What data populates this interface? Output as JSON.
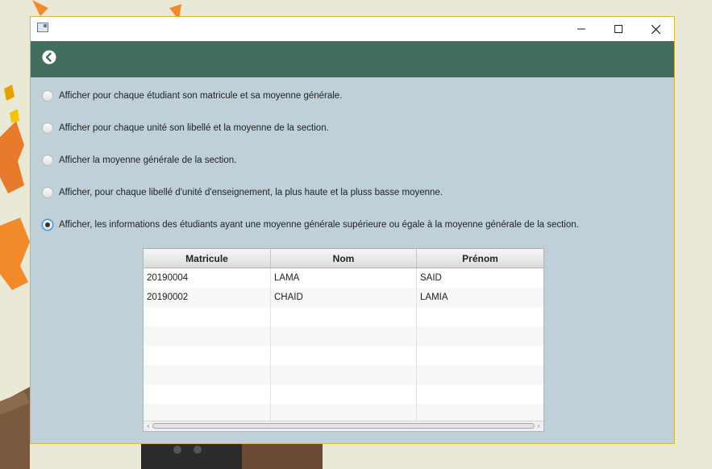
{
  "window": {
    "icon": "app-window-icon",
    "controls": [
      "minimize-icon",
      "maximize-icon",
      "close-icon"
    ]
  },
  "header": {
    "back_icon": "back-arrow-circle-icon",
    "color": "#436d5e"
  },
  "options": [
    {
      "label": "Afficher pour chaque étudiant son matricule et sa moyenne générale.",
      "checked": false
    },
    {
      "label": "Afficher pour chaque unité son libellé et la moyenne de la section.",
      "checked": false
    },
    {
      "label": "Afficher la moyenne générale de la section.",
      "checked": false
    },
    {
      "label": "Afficher, pour chaque libellé d'unité d'enseignement, la plus haute et la pluss basse moyenne.",
      "checked": false
    },
    {
      "label": "Afficher, les informations des étudiants ayant une moyenne générale supérieure ou égale à la moyenne générale de la section.",
      "checked": true
    }
  ],
  "table": {
    "columns": [
      "Matricule",
      "Nom",
      "Prénom"
    ],
    "rows": [
      [
        "20190004",
        "LAMA",
        "SAID"
      ],
      [
        "20190002",
        "CHAID",
        "LAMIA"
      ]
    ]
  },
  "colors": {
    "content_bg": "#bfd0d9",
    "window_border": "#d9b64a",
    "radio_focus": "#3c8fd6"
  }
}
